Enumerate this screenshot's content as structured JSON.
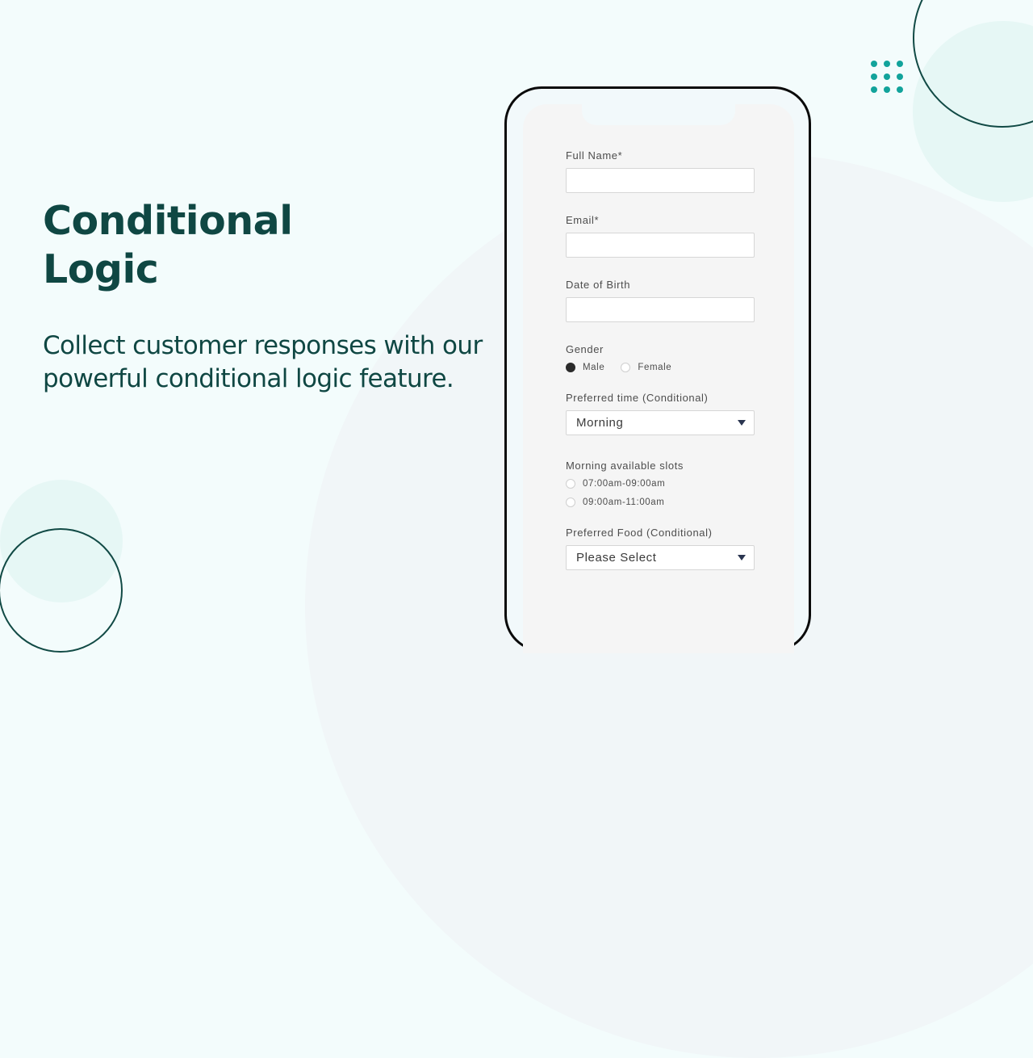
{
  "hero": {
    "title_line1": "Conditional",
    "title_line2": "Logic",
    "subtitle_line1": "Collect customer responses with our",
    "subtitle_line2": "powerful conditional logic feature."
  },
  "form": {
    "full_name": {
      "label": "Full Name*",
      "value": ""
    },
    "email": {
      "label": "Email*",
      "value": ""
    },
    "dob": {
      "label": "Date of Birth",
      "value": ""
    },
    "gender": {
      "label": "Gender",
      "options": [
        {
          "label": "Male",
          "checked": true
        },
        {
          "label": "Female",
          "checked": false
        }
      ]
    },
    "preferred_time": {
      "label": "Preferred time (Conditional)",
      "value": "Morning"
    },
    "slots": {
      "label": "Morning available slots",
      "options": [
        {
          "label": "07:00am-09:00am",
          "checked": false
        },
        {
          "label": "09:00am-11:00am",
          "checked": false
        }
      ]
    },
    "preferred_food": {
      "label": "Preferred Food (Conditional)",
      "value": "Please Select"
    }
  },
  "colors": {
    "heading": "#0f4743",
    "accent_dots": "#12a39b",
    "background": "#f3fcfc"
  }
}
